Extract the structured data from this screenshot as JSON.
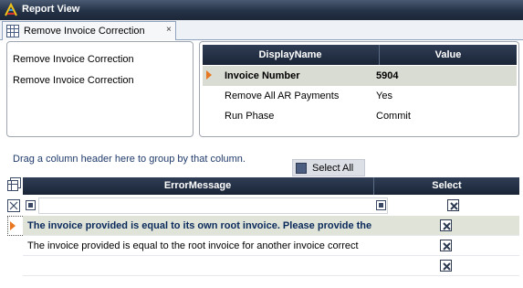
{
  "window": {
    "title": "Report View"
  },
  "tab": {
    "label": "Remove Invoice Correction",
    "close_glyph": "×"
  },
  "left_panel": {
    "lines": [
      "Remove Invoice Correction",
      "Remove Invoice Correction"
    ]
  },
  "properties": {
    "headers": {
      "name": "DisplayName",
      "value": "Value"
    },
    "rows": [
      {
        "name": "Invoice Number",
        "value": "5904",
        "selected": true
      },
      {
        "name": "Remove All AR Payments",
        "value": "Yes",
        "selected": false
      },
      {
        "name": "Run Phase",
        "value": "Commit",
        "selected": false
      }
    ]
  },
  "grid": {
    "group_hint": "Drag a column header here to group by that column.",
    "select_all_label": "Select All",
    "columns": {
      "message": "ErrorMessage",
      "select": "Select"
    },
    "rows": [
      {
        "message": "The invoice provided is equal to its own root invoice. Please provide the",
        "checked": true,
        "selected": true
      },
      {
        "message": "The invoice provided is equal to the root invoice for another invoice correct",
        "checked": true,
        "selected": false
      },
      {
        "message": "",
        "checked": true,
        "selected": false
      }
    ]
  },
  "icons": {
    "app": "report-app-icon",
    "tab": "grid-tab-icon",
    "grid_corner": "column-chooser-icon",
    "filter": "filter-icon"
  },
  "colors": {
    "titlebar": "#243247",
    "header": "#1a2436",
    "selected_row": "#dfe3d8",
    "indicator": "#e87722",
    "group_hint": "#1f3a6b"
  }
}
